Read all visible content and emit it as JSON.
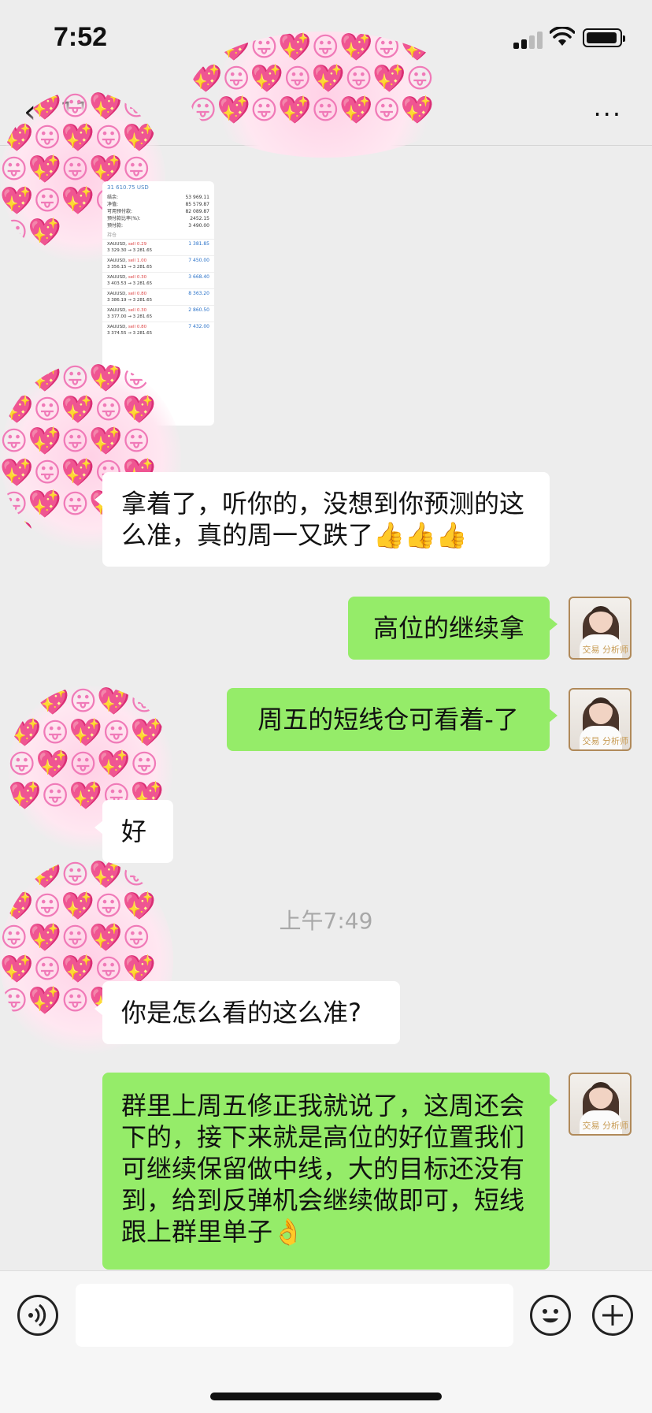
{
  "status_bar": {
    "time": "7:52"
  },
  "nav": {
    "back_glyph": "‹",
    "unread_count": "11",
    "more_glyph": "···"
  },
  "messages": {
    "m1": "拿着了，听你的，没想到你预测的这么准，真的周一又跌了👍👍👍",
    "m2": "高位的继续拿",
    "m3": "周五的短线仓可看着-了",
    "m4": "好",
    "timestamp": "上午7:49",
    "m5": "你是怎么看的这么准?",
    "m6": "群里上周五修正我就说了，这周还会下的，接下来就是高位的好位置我们可继续保留做中线，大的目标还没有到，给到反弹机会继续做即可，短线跟上群里单子👌"
  },
  "screenshot_image": {
    "header": "31 610.75 USD",
    "rows": [
      {
        "k": "结余:",
        "v": "53 969.11"
      },
      {
        "k": "净值:",
        "v": "85 579.87"
      },
      {
        "k": "可用预付款:",
        "v": "82 089.87"
      },
      {
        "k": "预付款比率(%):",
        "v": "2452.15"
      },
      {
        "k": "预付款:",
        "v": "3 490.00"
      }
    ],
    "section": "持仓",
    "trades": [
      {
        "sym": "XAUUSD,",
        "side": "sell 0.29",
        "px": "3 329.30 → 3 281.65",
        "pl": "1 381.85"
      },
      {
        "sym": "XAUUSD,",
        "side": "sell 1.00",
        "px": "3 356.15 → 3 281.65",
        "pl": "7 450.00"
      },
      {
        "sym": "XAUUSD,",
        "side": "sell 0.30",
        "px": "3 403.53 → 3 281.65",
        "pl": "3 668.40"
      },
      {
        "sym": "XAUUSD,",
        "side": "sell 0.80",
        "px": "3 386.19 → 3 281.65",
        "pl": "8 363.20"
      },
      {
        "sym": "XAUUSD,",
        "side": "sell 0.30",
        "px": "3 377.00 → 3 281.65",
        "pl": "2 860.50"
      },
      {
        "sym": "XAUUSD,",
        "side": "sell 0.80",
        "px": "3 374.55 → 3 281.65",
        "pl": "7 432.00"
      }
    ]
  },
  "avatar": {
    "tag": "交易 分析师"
  },
  "input": {
    "voice_glyph": "◉",
    "emoji_glyph": "☺",
    "plus_glyph": "+"
  },
  "colors": {
    "outgoing_bubble": "#95ec69",
    "incoming_bubble": "#ffffff",
    "background": "#ededed"
  }
}
